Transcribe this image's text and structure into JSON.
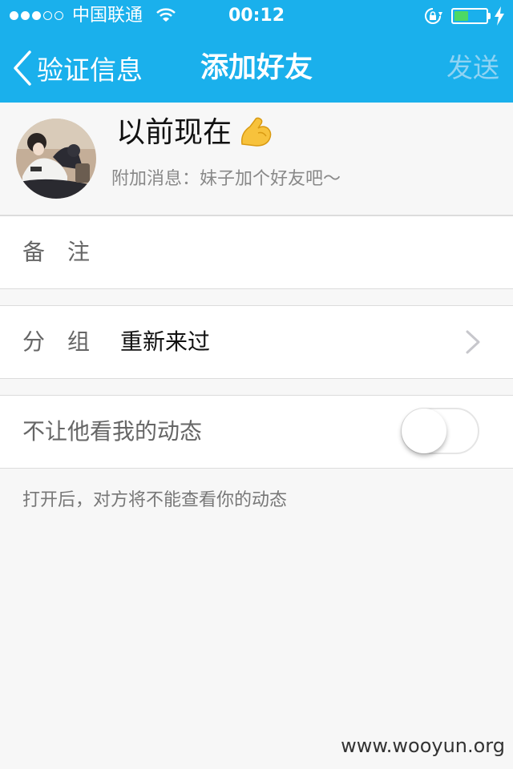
{
  "status_bar": {
    "carrier": "中国联通",
    "time": "00:12",
    "signal_bars": 3,
    "signal_max": 5,
    "battery_level": 0.45,
    "battery_color": "#4cd964"
  },
  "nav": {
    "back_label": "验证信息",
    "title": "添加好友",
    "send_label": "发送",
    "bar_color": "#1ab0ec"
  },
  "profile": {
    "nickname": "以前现在",
    "extra_message": "附加消息：妹子加个好友吧～",
    "emoji_icon": "flexed-biceps-icon"
  },
  "remark": {
    "label": "备　注",
    "value": ""
  },
  "group": {
    "label": "分　组",
    "value": "重新来过"
  },
  "privacy": {
    "label": "不让他看我的动态",
    "enabled": false,
    "hint": "打开后，对方将不能查看你的动态"
  },
  "watermark": "www.wooyun.org"
}
